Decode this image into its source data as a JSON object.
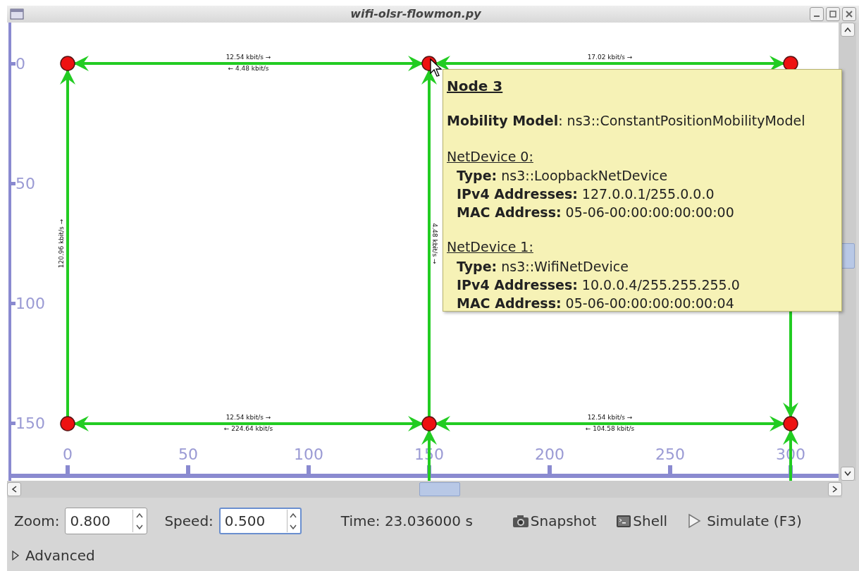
{
  "window": {
    "title": "wifi-olsr-flowmon.py"
  },
  "y_axis": {
    "ticks": [
      "0",
      "50",
      "100",
      "150"
    ]
  },
  "x_axis": {
    "ticks": [
      "0",
      "50",
      "100",
      "150",
      "200",
      "250",
      "300"
    ]
  },
  "links": [
    {
      "kind": "link",
      "labels": [
        "12.54 kbit/s →",
        "← 4.48 kbit/s"
      ]
    },
    {
      "kind": "link",
      "labels": [
        "17.02 kbit/s →"
      ]
    },
    {
      "kind": "link",
      "labels": [
        "120.96 kbit/s →"
      ]
    },
    {
      "kind": "link",
      "labels": [
        "4.48 kbit/s →"
      ]
    },
    {
      "kind": "link",
      "labels": [
        "12.54 kbit/s →",
        "← 224.64 kbit/s"
      ]
    },
    {
      "kind": "link",
      "labels": [
        "12.54 kbit/s →",
        "← 104.58 kbit/s"
      ]
    },
    {
      "kind": "link"
    }
  ],
  "tooltip": {
    "title": "Node 3",
    "lines": [
      "**Mobility Model**: ns3::ConstantPositionMobilityModel"
    ],
    "devices": [
      {
        "title": "NetDevice 0:",
        "fields": [
          "**Type:** ns3::LoopbackNetDevice",
          "**IPv4 Addresses:** 127.0.0.1/255.0.0.0",
          "**MAC Address:** 05-06-00:00:00:00:00:00"
        ]
      },
      {
        "title": "NetDevice 1:",
        "fields": [
          "**Type:** ns3::WifiNetDevice",
          "**IPv4 Addresses:** 10.0.0.4/255.255.255.0",
          "**MAC Address:** 05-06-00:00:00:00:00:04"
        ]
      }
    ]
  },
  "controls": {
    "zoom": {
      "label": "Zoom:",
      "value": "0.800",
      "focused": false
    },
    "speed": {
      "label": "Speed:",
      "value": "0.500",
      "focused": true
    },
    "time": "Time: 23.036000 s",
    "buttons": [
      {
        "kind": "camera",
        "label": "Snapshot"
      },
      {
        "kind": "terminal",
        "label": "Shell"
      },
      {
        "kind": "play",
        "label": "Simulate (F3)"
      }
    ]
  },
  "advanced": {
    "label": "Advanced",
    "expanded": false
  }
}
